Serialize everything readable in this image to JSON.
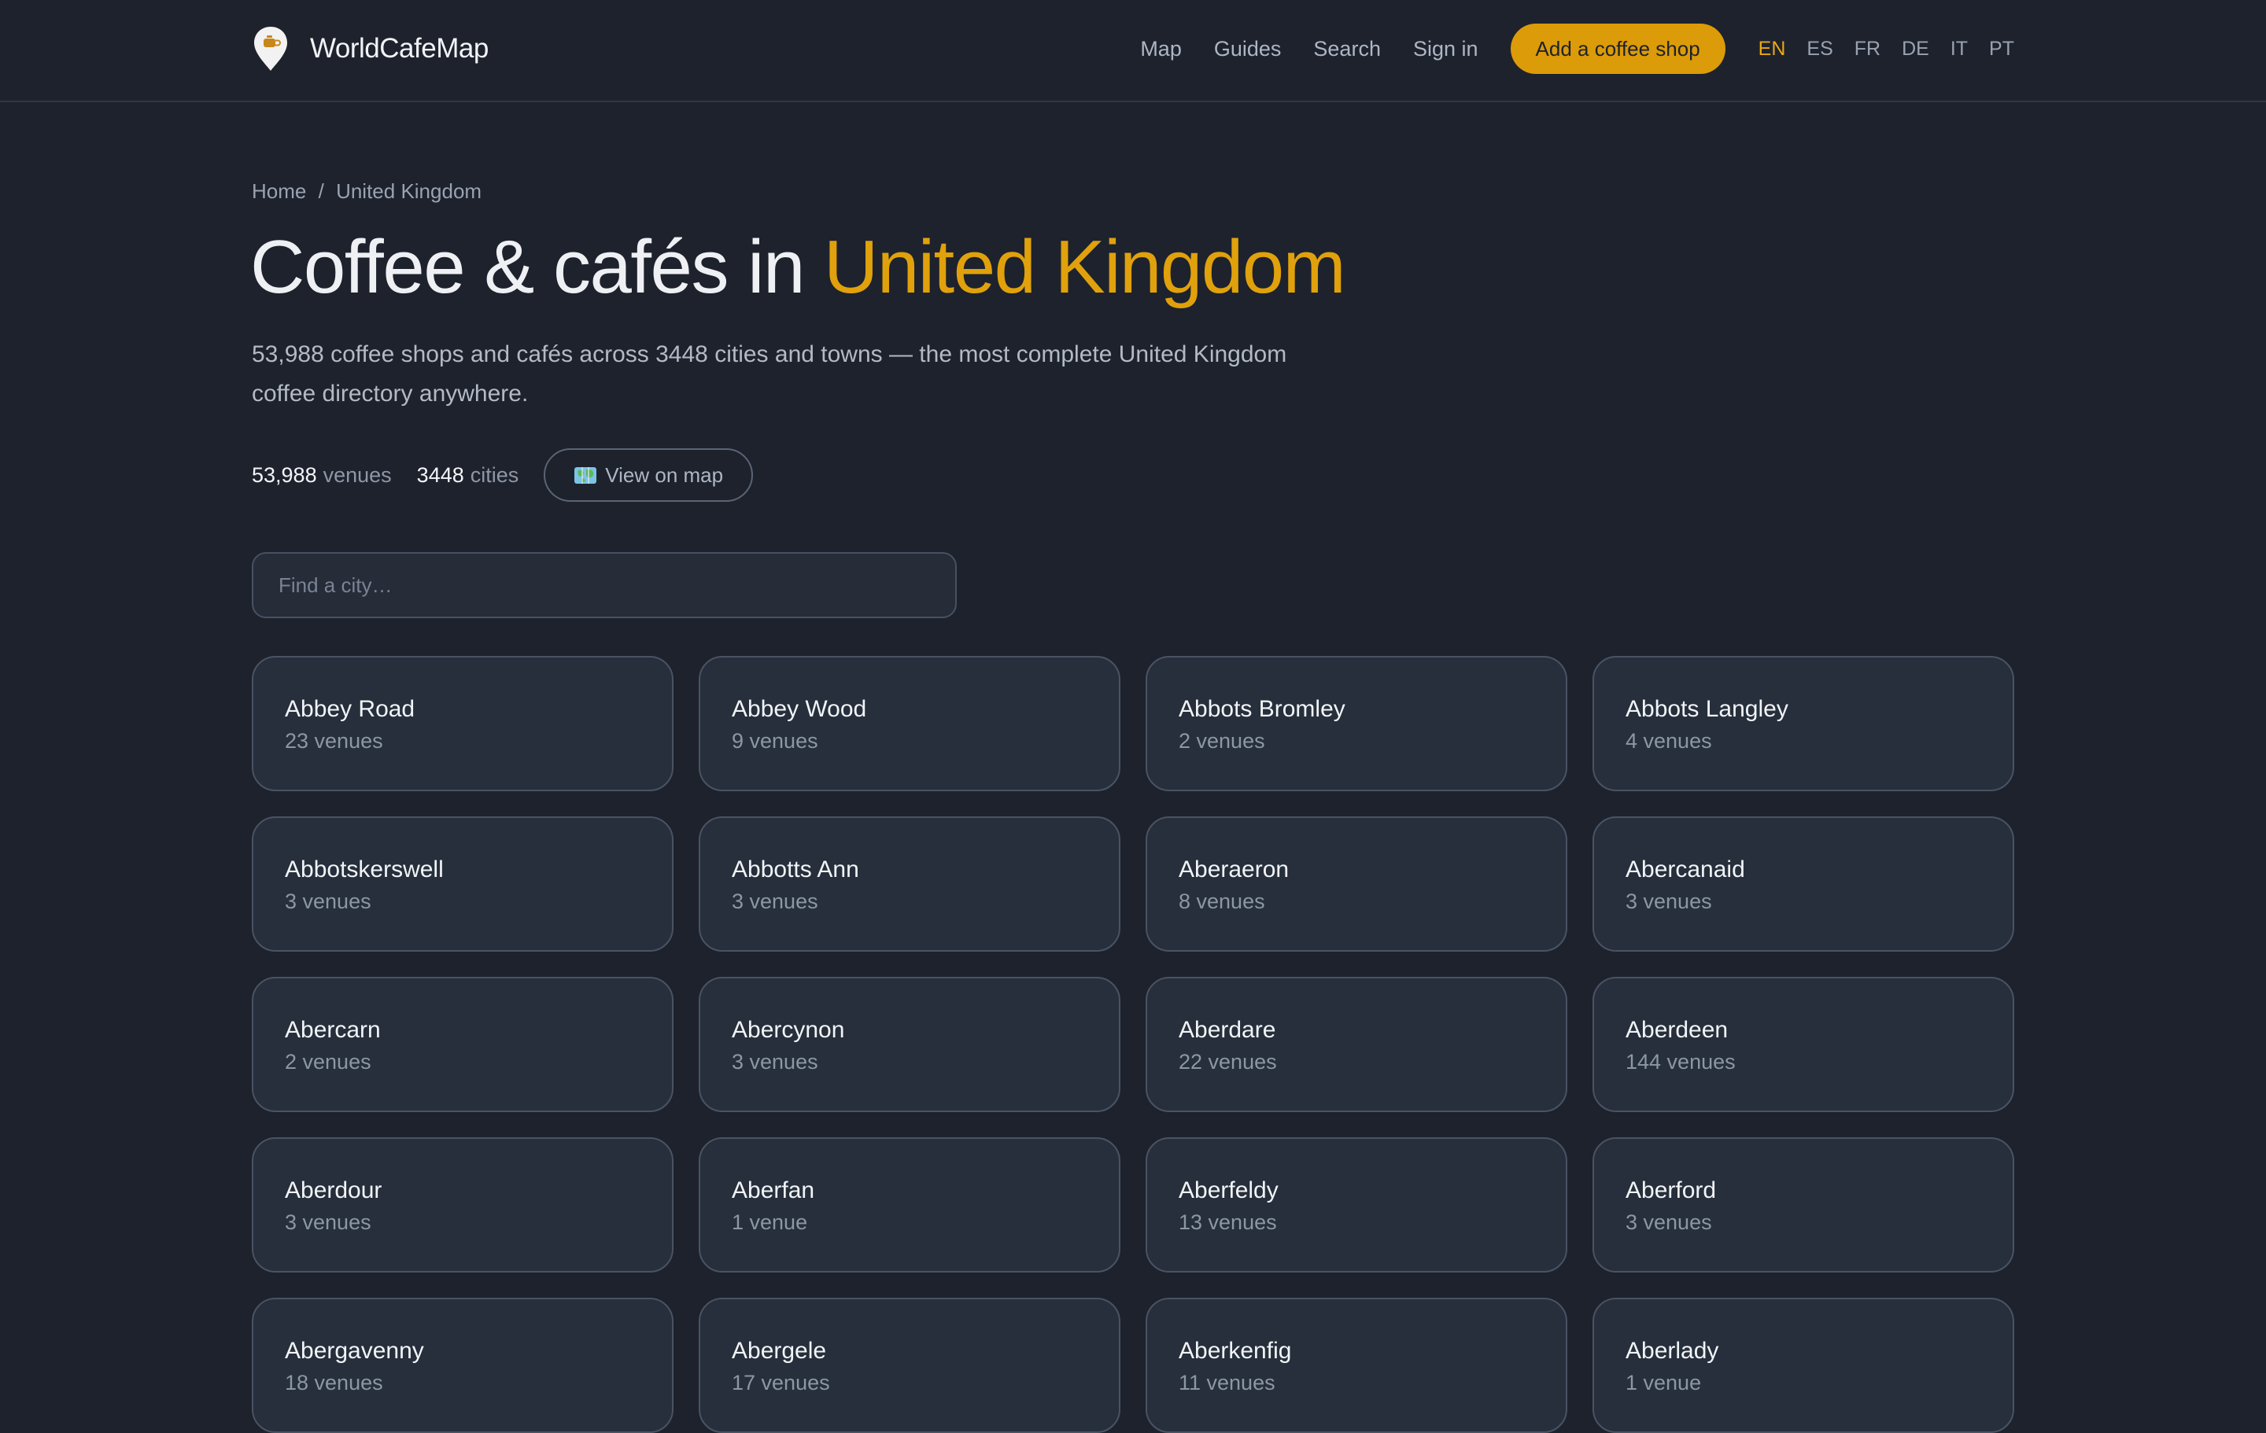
{
  "header": {
    "brand": "WorldCafeMap",
    "nav": [
      "Map",
      "Guides",
      "Search",
      "Sign in"
    ],
    "cta_label": "Add a coffee shop",
    "languages": [
      "EN",
      "ES",
      "FR",
      "DE",
      "IT",
      "PT"
    ],
    "active_language": "EN",
    "colors": {
      "accent": "#dc9b08",
      "background": "#1d222d"
    }
  },
  "breadcrumb": {
    "home": "Home",
    "separator": "/",
    "current": "United Kingdom"
  },
  "title": {
    "prefix": "Coffee & cafés in",
    "highlight": "United Kingdom"
  },
  "subtitle": "53,988 coffee shops and cafés across 3448 cities and towns — the most complete United Kingdom coffee directory anywhere.",
  "stats": {
    "venues_value": "53,988",
    "venues_label": "venues",
    "cities_value": "3448",
    "cities_label": "cities",
    "map_button_label": "View on map",
    "map_button_icon": "world-map-icon"
  },
  "search": {
    "placeholder": "Find a city…",
    "value": ""
  },
  "cities": [
    {
      "name": "Abbey Road",
      "count": "23 venues"
    },
    {
      "name": "Abbey Wood",
      "count": "9 venues"
    },
    {
      "name": "Abbots Bromley",
      "count": "2 venues"
    },
    {
      "name": "Abbots Langley",
      "count": "4 venues"
    },
    {
      "name": "Abbotskerswell",
      "count": "3 venues"
    },
    {
      "name": "Abbotts Ann",
      "count": "3 venues"
    },
    {
      "name": "Aberaeron",
      "count": "8 venues"
    },
    {
      "name": "Abercanaid",
      "count": "3 venues"
    },
    {
      "name": "Abercarn",
      "count": "2 venues"
    },
    {
      "name": "Abercynon",
      "count": "3 venues"
    },
    {
      "name": "Aberdare",
      "count": "22 venues"
    },
    {
      "name": "Aberdeen",
      "count": "144 venues"
    },
    {
      "name": "Aberdour",
      "count": "3 venues"
    },
    {
      "name": "Aberfan",
      "count": "1 venue"
    },
    {
      "name": "Aberfeldy",
      "count": "13 venues"
    },
    {
      "name": "Aberford",
      "count": "3 venues"
    },
    {
      "name": "Abergavenny",
      "count": "18 venues"
    },
    {
      "name": "Abergele",
      "count": "17 venues"
    },
    {
      "name": "Aberkenfig",
      "count": "11 venues"
    },
    {
      "name": "Aberlady",
      "count": "1 venue"
    }
  ]
}
